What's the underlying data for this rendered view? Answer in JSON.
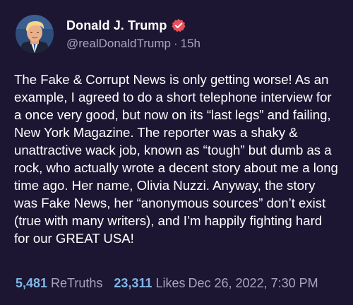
{
  "author": {
    "display_name": "Donald J. Trump",
    "handle": "@realDonaldTrump",
    "time_ago": "15h",
    "separator": "·",
    "verified_icon": "verified-badge-icon",
    "verified_color": "#e8505b"
  },
  "post": {
    "text": "The Fake & Corrupt News is only getting worse! As an example, I agreed to do a short telephone interview for a once very good, but now on its “last legs” and failing, New York Magazine. The reporter was a shaky & unattractive wack job, known as “tough” but dumb as a rock, who actually wrote a decent story about me a long time ago. Her name, Olivia Nuzzi. Anyway, the story was Fake News, her “anonymous sources” don’t exist (true with many writers), and I’m happily fighting hard for our GREAT USA!"
  },
  "stats": {
    "retruths_count": "5,481",
    "retruths_label": "ReTruths",
    "likes_count": "23,311",
    "likes_label": "Likes",
    "timestamp": "Dec 26, 2022, 7:30 PM"
  },
  "colors": {
    "background": "#1c1633",
    "accent": "#7fb6e6",
    "muted": "#a8a4c0"
  }
}
